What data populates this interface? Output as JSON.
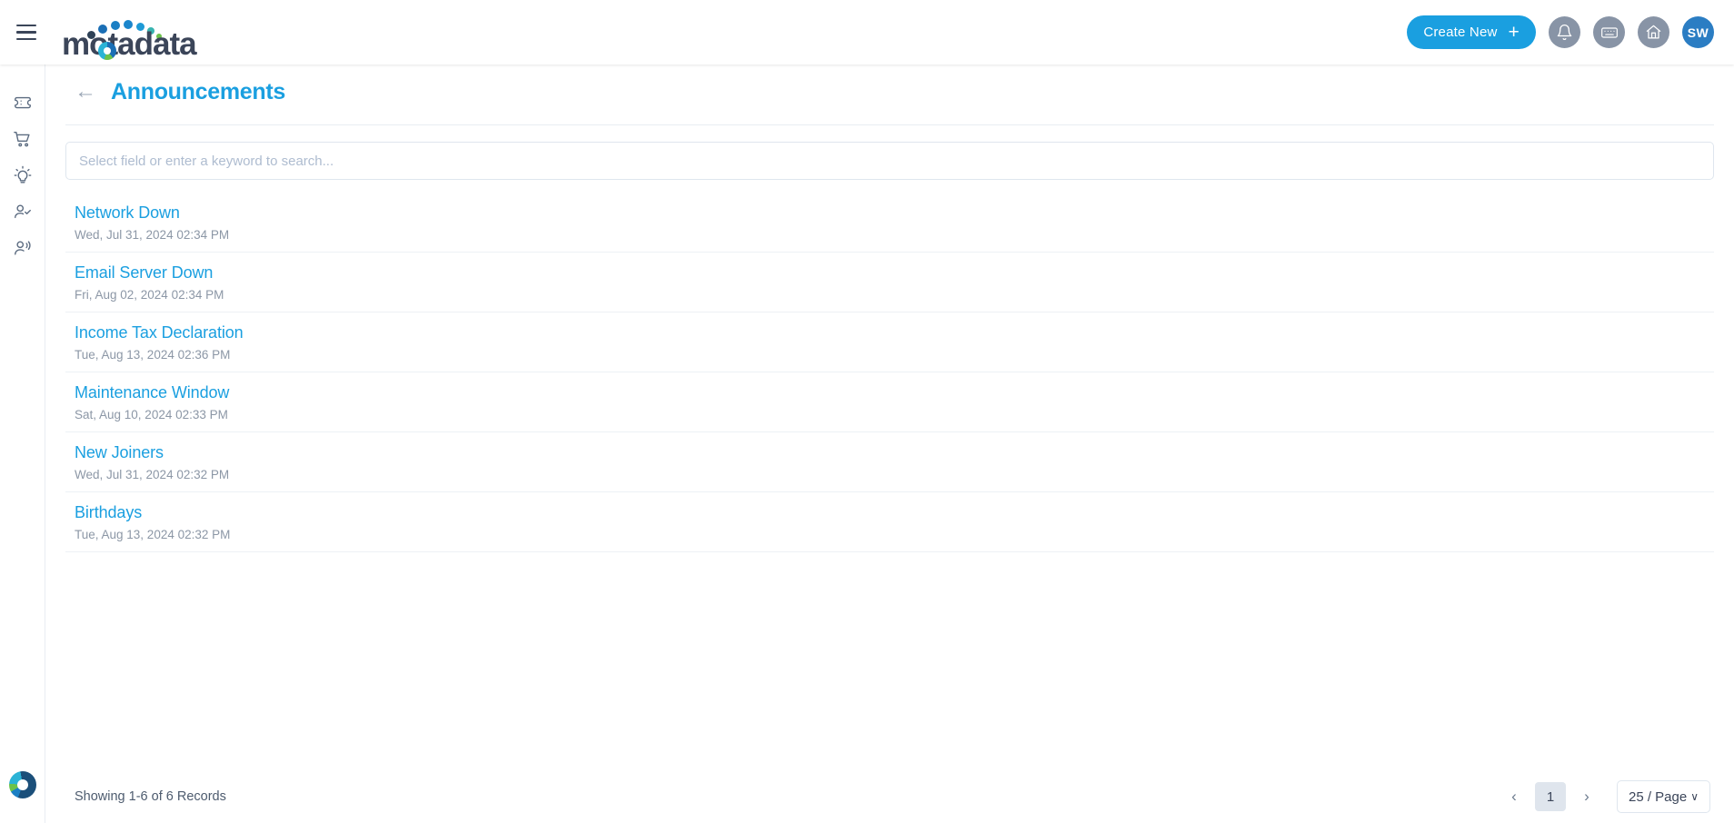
{
  "header": {
    "menu_icon": "hamburger-icon",
    "brand_name": "motadata",
    "create_new_label": "Create New",
    "create_new_plus": "+",
    "notifications_icon": "bell-icon",
    "keyboard_icon": "keyboard-icon",
    "home_icon": "home-icon",
    "avatar_initials": "SW",
    "accent_color": "#1a9fe0",
    "avatar_color": "#2b7dc3",
    "icon_circle_color": "#8894a6"
  },
  "sidebar": {
    "items": [
      {
        "name": "ticket-icon",
        "label": "Tickets"
      },
      {
        "name": "cart-icon",
        "label": "Service Catalog"
      },
      {
        "name": "lightbulb-icon",
        "label": "Knowledge"
      },
      {
        "name": "user-check-icon",
        "label": "Approvals"
      },
      {
        "name": "announcement-user-icon",
        "label": "Announcements"
      }
    ],
    "bottom_logo": "motadata-ring-logo"
  },
  "page": {
    "back_arrow": "←",
    "title": "Announcements"
  },
  "search": {
    "placeholder": "Select field or enter a keyword to search...",
    "value": ""
  },
  "announcements": [
    {
      "title": "Network Down",
      "date": "Wed, Jul 31, 2024 02:34 PM"
    },
    {
      "title": "Email Server Down",
      "date": "Fri, Aug 02, 2024 02:34 PM"
    },
    {
      "title": "Income Tax Declaration",
      "date": "Tue, Aug 13, 2024 02:36 PM"
    },
    {
      "title": "Maintenance Window",
      "date": "Sat, Aug 10, 2024 02:33 PM"
    },
    {
      "title": "New Joiners",
      "date": "Wed, Jul 31, 2024 02:32 PM"
    },
    {
      "title": "Birthdays",
      "date": "Tue, Aug 13, 2024 02:32 PM"
    }
  ],
  "footer": {
    "records_text": "Showing 1-6 of 6 Records",
    "prev_label": "‹",
    "current_page": "1",
    "next_label": "›",
    "page_size_label": "25 / Page",
    "page_size_chevron": "∨"
  }
}
